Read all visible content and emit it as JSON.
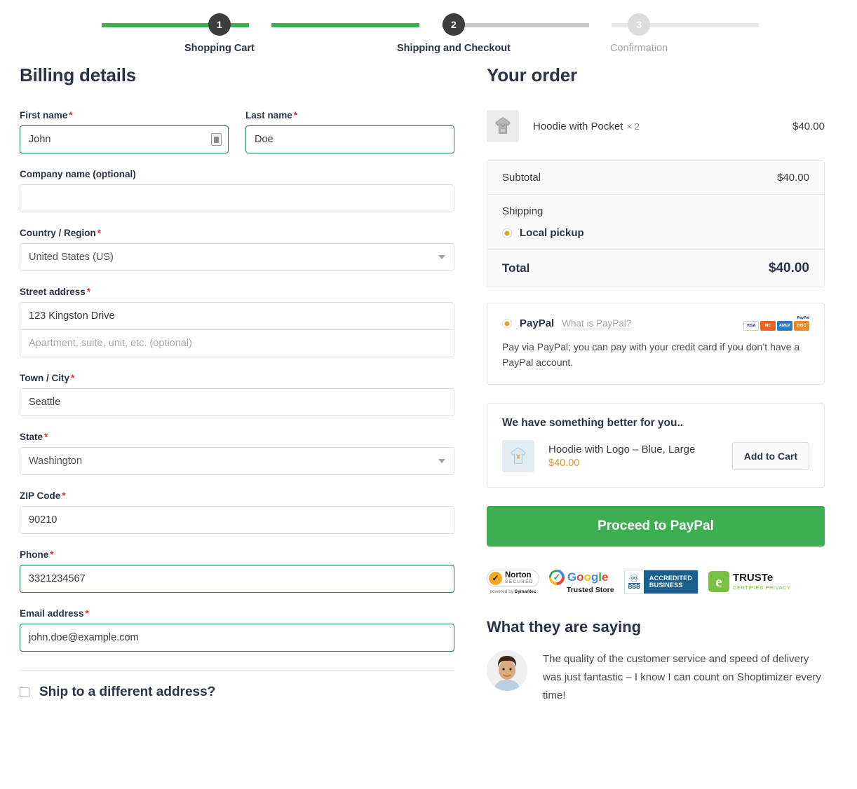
{
  "progress": {
    "steps": [
      {
        "num": "1",
        "label": "Shopping Cart",
        "state": "active"
      },
      {
        "num": "2",
        "label": "Shipping and Checkout",
        "state": "active"
      },
      {
        "num": "3",
        "label": "Confirmation",
        "state": "inactive"
      }
    ]
  },
  "billing": {
    "title": "Billing details",
    "first_name": {
      "label": "First name",
      "value": "John",
      "required": "*"
    },
    "last_name": {
      "label": "Last name",
      "value": "Doe",
      "required": "*"
    },
    "company": {
      "label": "Company name (optional)",
      "value": ""
    },
    "country": {
      "label": "Country / Region",
      "value": "United States (US)",
      "required": "*"
    },
    "street": {
      "label": "Street address",
      "value": "123 Kingston Drive",
      "required": "*"
    },
    "apartment": {
      "placeholder": "Apartment, suite, unit, etc. (optional)",
      "value": ""
    },
    "city": {
      "label": "Town / City",
      "value": "Seattle",
      "required": "*"
    },
    "state": {
      "label": "State",
      "value": "Washington",
      "required": "*"
    },
    "zip": {
      "label": "ZIP Code",
      "value": "90210",
      "required": "*"
    },
    "phone": {
      "label": "Phone",
      "value": "3321234567",
      "required": "*"
    },
    "email": {
      "label": "Email address",
      "value": "john.doe@example.com",
      "required": "*"
    },
    "ship_different_label": "Ship to a different address?"
  },
  "order": {
    "title": "Your order",
    "items": [
      {
        "name": "Hoodie with Pocket",
        "qty": "× 2",
        "price": "$40.00"
      }
    ],
    "subtotal_label": "Subtotal",
    "subtotal_value": "$40.00",
    "shipping_label": "Shipping",
    "shipping_method": "Local pickup",
    "total_label": "Total",
    "total_value": "$40.00"
  },
  "payment": {
    "name": "PayPal",
    "what_is_link": "What is PayPal?",
    "description": "Pay via PayPal; you can pay with your credit card if you don’t have a PayPal account.",
    "cards": [
      "VISA",
      "MC",
      "AMEX",
      "DISC"
    ],
    "paypal_mini_logo": "PayPal"
  },
  "upsell": {
    "title": "We have something better for you..",
    "product_name": "Hoodie with Logo – Blue, Large",
    "product_price": "$40.00",
    "add_button": "Add to Cart"
  },
  "cta": {
    "label": "Proceed to PayPal"
  },
  "badges": {
    "norton": {
      "line1": "Norton",
      "line2": "SECURED",
      "sub_prefix": "powered by ",
      "sub_brand": "Symantec"
    },
    "google": {
      "word": "Google",
      "sub": "Trusted Store"
    },
    "bbb": {
      "abbr": "BBB",
      "line1": "ACCREDITED",
      "line2": "BUSINESS"
    },
    "truste": {
      "line1": "TRUSTe",
      "line2": "CERTIFIED PRIVACY"
    }
  },
  "testimonial": {
    "title": "What they are saying",
    "quote": "The quality of the customer service and speed of delivery was just fantastic – I know I can count on Shoptimizer every time!"
  },
  "colors": {
    "accent_green": "#3eaf51",
    "required_red": "#e02b2b",
    "shipping_orange": "#e8a020",
    "price_orange": "#e0962a",
    "active_step": "#3d3d3d",
    "inactive_step": "#dcdcdc"
  }
}
